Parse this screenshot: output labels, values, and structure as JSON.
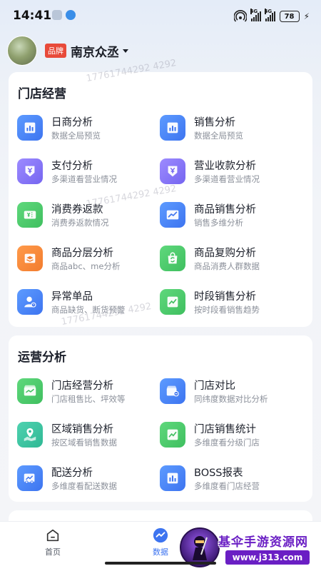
{
  "status_bar": {
    "time": "14:41",
    "network_1": "4G",
    "network_2": "4G",
    "battery": "78"
  },
  "header": {
    "brand_badge": "品牌",
    "store_name": "南京众丞"
  },
  "sections": [
    {
      "title": "门店经营",
      "items": [
        {
          "title": "日商分析",
          "subtitle": "数据全局预览",
          "icon": "bar-chart-icon",
          "color": "#4a86f7"
        },
        {
          "title": "销售分析",
          "subtitle": "数据全局预览",
          "icon": "bar-chart-icon",
          "color": "#4a86f7"
        },
        {
          "title": "支付分析",
          "subtitle": "多渠道看营业情况",
          "icon": "yen-shield-icon",
          "color": "#8a78f7"
        },
        {
          "title": "营业收款分析",
          "subtitle": "多渠道看营业情况",
          "icon": "yen-shield-icon",
          "color": "#8a78f7"
        },
        {
          "title": "消费券返款",
          "subtitle": "消费券返款情况",
          "icon": "coupon-icon",
          "color": "#4ccc6c"
        },
        {
          "title": "商品销售分析",
          "subtitle": "销售多维分析",
          "icon": "line-window-icon",
          "color": "#4a86f7"
        },
        {
          "title": "商品分层分析",
          "subtitle": "商品abc、me分析",
          "icon": "layers-icon",
          "color": "#f58a3a"
        },
        {
          "title": "商品复购分析",
          "subtitle": "商品消费人群数据",
          "icon": "repurchase-bag-icon",
          "color": "#4ccc6c"
        },
        {
          "title": "异常单品",
          "subtitle": "商品缺货、断货预警",
          "icon": "person-alert-icon",
          "color": "#4a86f7"
        },
        {
          "title": "时段销售分析",
          "subtitle": "按时段看销售趋势",
          "icon": "trend-icon",
          "color": "#4ccc6c"
        }
      ]
    },
    {
      "title": "运营分析",
      "items": [
        {
          "title": "门店经营分析",
          "subtitle": "门店租售比、坪效等",
          "icon": "store-chart-icon",
          "color": "#4ccc6c"
        },
        {
          "title": "门店对比",
          "subtitle": "同纬度数据对比分析",
          "icon": "store-compare-icon",
          "color": "#4a86f7"
        },
        {
          "title": "区域销售分析",
          "subtitle": "按区域看销售数据",
          "icon": "map-pin-icon",
          "color": "#3fc4a0"
        },
        {
          "title": "门店销售统计",
          "subtitle": "多维度看分级门店",
          "icon": "trend-icon",
          "color": "#4ccc6c"
        },
        {
          "title": "配送分析",
          "subtitle": "多维度看配送数据",
          "icon": "delivery-truck-icon",
          "color": "#4a86f7"
        },
        {
          "title": "BOSS报表",
          "subtitle": "多维度看门店经营",
          "icon": "report-icon",
          "color": "#4a86f7"
        }
      ]
    }
  ],
  "bottom_nav": [
    {
      "label": "首页",
      "icon": "home-icon",
      "active": false
    },
    {
      "label": "数据",
      "icon": "data-icon",
      "active": true
    }
  ],
  "watermark": "17761744292 4292",
  "overlay": {
    "site_title": "基伞手游资源网",
    "site_url": "www.j313.com"
  }
}
